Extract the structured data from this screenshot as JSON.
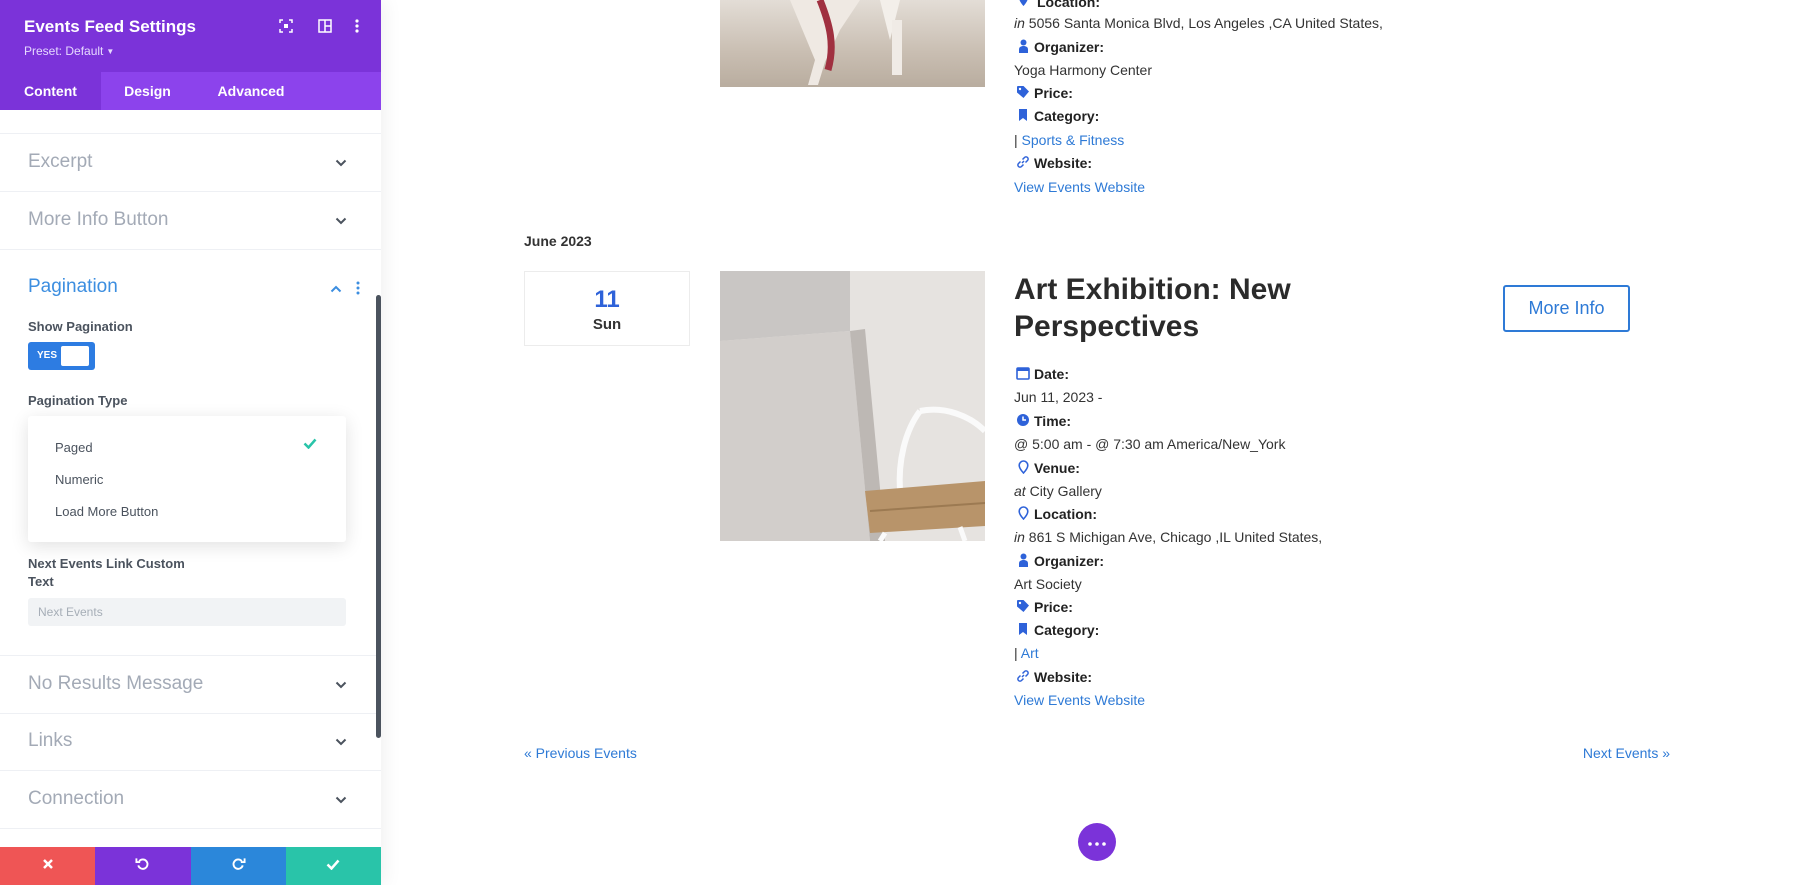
{
  "panel": {
    "title": "Events Feed Settings",
    "preset": "Preset: Default",
    "tabs": [
      {
        "label": "Content",
        "active": true
      },
      {
        "label": "Design",
        "active": false
      },
      {
        "label": "Advanced",
        "active": false
      }
    ],
    "sections_top": [
      "Excerpt",
      "More Info Button"
    ],
    "pagination": {
      "title": "Pagination",
      "show_label": "Show Pagination",
      "toggle_text": "YES",
      "type_label": "Pagination Type",
      "options": [
        "Paged",
        "Numeric",
        "Load More Button"
      ],
      "selected": "Paged",
      "next_label_line1": "Next Events Link Custom",
      "next_label_line2": "Text",
      "next_placeholder": "Next Events"
    },
    "sections_bottom": [
      "No Results Message",
      "Links",
      "Connection"
    ],
    "colors": {
      "header": "#7b33d9",
      "tab_bar": "#8c43ec",
      "cancel": "#ef5555",
      "undo": "#7b33d9",
      "redo": "#2b87da",
      "save": "#29c4a9"
    }
  },
  "labels": {
    "location": "Location:",
    "organizer": "Organizer:",
    "price": "Price:",
    "category": "Category:",
    "website": "Website:",
    "date": "Date:",
    "time": "Time:",
    "venue": "Venue:",
    "in": "in",
    "at": "at",
    "sep": "|"
  },
  "event1": {
    "address": "5056 Santa Monica Blvd, Los Angeles ,CA United States,",
    "organizer": "Yoga Harmony Center",
    "category": "Sports & Fitness",
    "website_link": "View Events Website"
  },
  "month_heading": "June 2023",
  "event2": {
    "day": "11",
    "weekday": "Sun",
    "title": "Art Exhibition: New Perspectives",
    "more_info": "More Info",
    "date": "Jun 11, 2023 -",
    "time": "@ 5:00 am - @ 7:30 am America/New_York",
    "venue": "City Gallery",
    "address": "861 S Michigan Ave, Chicago ,IL United States,",
    "organizer": "Art Society",
    "category": "Art",
    "website_link": "View Events Website"
  },
  "pager": {
    "previous": "« Previous Events",
    "next": "Next Events »"
  },
  "icons": {
    "cancel": "close-icon",
    "undo": "undo-icon",
    "redo": "redo-icon",
    "save": "check-icon",
    "fab": "ellipsis-icon"
  }
}
